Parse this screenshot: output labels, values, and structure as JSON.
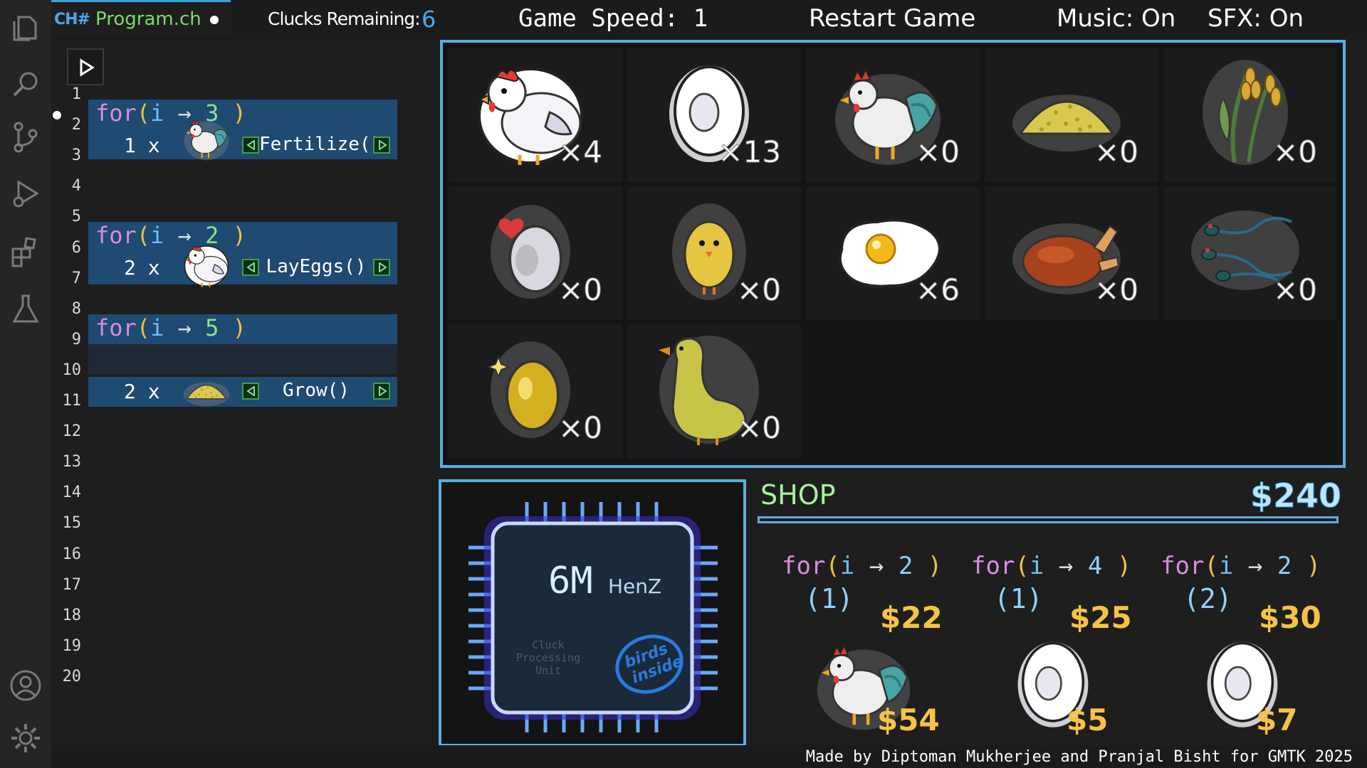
{
  "header": {
    "tab_lang": "CH#",
    "tab_file": "Program.ch",
    "clucks_label": "Clucks Remaining:",
    "clucks_value": "6",
    "game_speed": "Game Speed: 1",
    "restart": "Restart Game",
    "music": "Music: On",
    "sfx": "SFX: On"
  },
  "activity_icons": [
    "files-icon",
    "search-icon",
    "source-control-icon",
    "run-debug-icon",
    "extensions-icon",
    "testing-icon",
    "account-icon",
    "settings-gear-icon"
  ],
  "editor": {
    "line_numbers": [
      "1",
      "2",
      "3",
      "4",
      "5",
      "6",
      "7",
      "8",
      "9",
      "10",
      "11",
      "12",
      "13",
      "14",
      "15",
      "16",
      "17",
      "18",
      "19",
      "20"
    ],
    "loops": [
      {
        "keyword": "for",
        "var": "i",
        "count": "3"
      },
      {
        "keyword": "for",
        "var": "i",
        "count": "2"
      },
      {
        "keyword": "for",
        "var": "i",
        "count": "5"
      }
    ],
    "commands": [
      {
        "count": "1 x",
        "icon": "rooster-icon",
        "name": "Fertilize()"
      },
      {
        "count": "2 x",
        "icon": "chicken-icon",
        "name": "LayEggs()"
      },
      {
        "count": "2 x",
        "icon": "feed-pile-icon",
        "name": "Grow()"
      }
    ]
  },
  "inventory": [
    {
      "icon": "chicken-icon",
      "count": "×4"
    },
    {
      "icon": "egg-icon",
      "count": "×13"
    },
    {
      "icon": "rooster-icon",
      "count": "×0"
    },
    {
      "icon": "feed-pile-icon",
      "count": "×0"
    },
    {
      "icon": "wheat-icon",
      "count": "×0"
    },
    {
      "icon": "fertilized-egg-icon",
      "count": "×0"
    },
    {
      "icon": "chick-icon",
      "count": "×0"
    },
    {
      "icon": "fried-egg-icon",
      "count": "×6"
    },
    {
      "icon": "roast-chicken-icon",
      "count": "×0"
    },
    {
      "icon": "sperm-icon",
      "count": "×0"
    },
    {
      "icon": "golden-egg-icon",
      "count": "×0"
    },
    {
      "icon": "duck-icon",
      "count": "×0"
    }
  ],
  "cpu": {
    "speed_value": "6M",
    "speed_unit": "HenZ",
    "caption": [
      "Cluck",
      "Processing",
      "Unit"
    ],
    "badge": [
      "birds",
      "inside"
    ]
  },
  "shop": {
    "title": "SHOP",
    "money": "$240",
    "items": [
      {
        "keyword": "for",
        "var": "i",
        "count": "2",
        "qty": "(1)",
        "price": "$22",
        "icon": "rooster-icon",
        "sale": "$54"
      },
      {
        "keyword": "for",
        "var": "i",
        "count": "4",
        "qty": "(1)",
        "price": "$25",
        "icon": "egg-icon",
        "sale": "$5"
      },
      {
        "keyword": "for",
        "var": "i",
        "count": "2",
        "qty": "(2)",
        "price": "$30",
        "icon": "egg-icon",
        "sale": "$7"
      }
    ]
  },
  "footer": {
    "credits": "Made by Diptoman Mukherjee and Pranjal Bisht for GMTK 2025"
  },
  "colors": {
    "accent_blue": "#5aaee0",
    "block_blue": "#1f4a72",
    "price_gold": "#f6c344",
    "shop_green": "#a8f0a0"
  }
}
